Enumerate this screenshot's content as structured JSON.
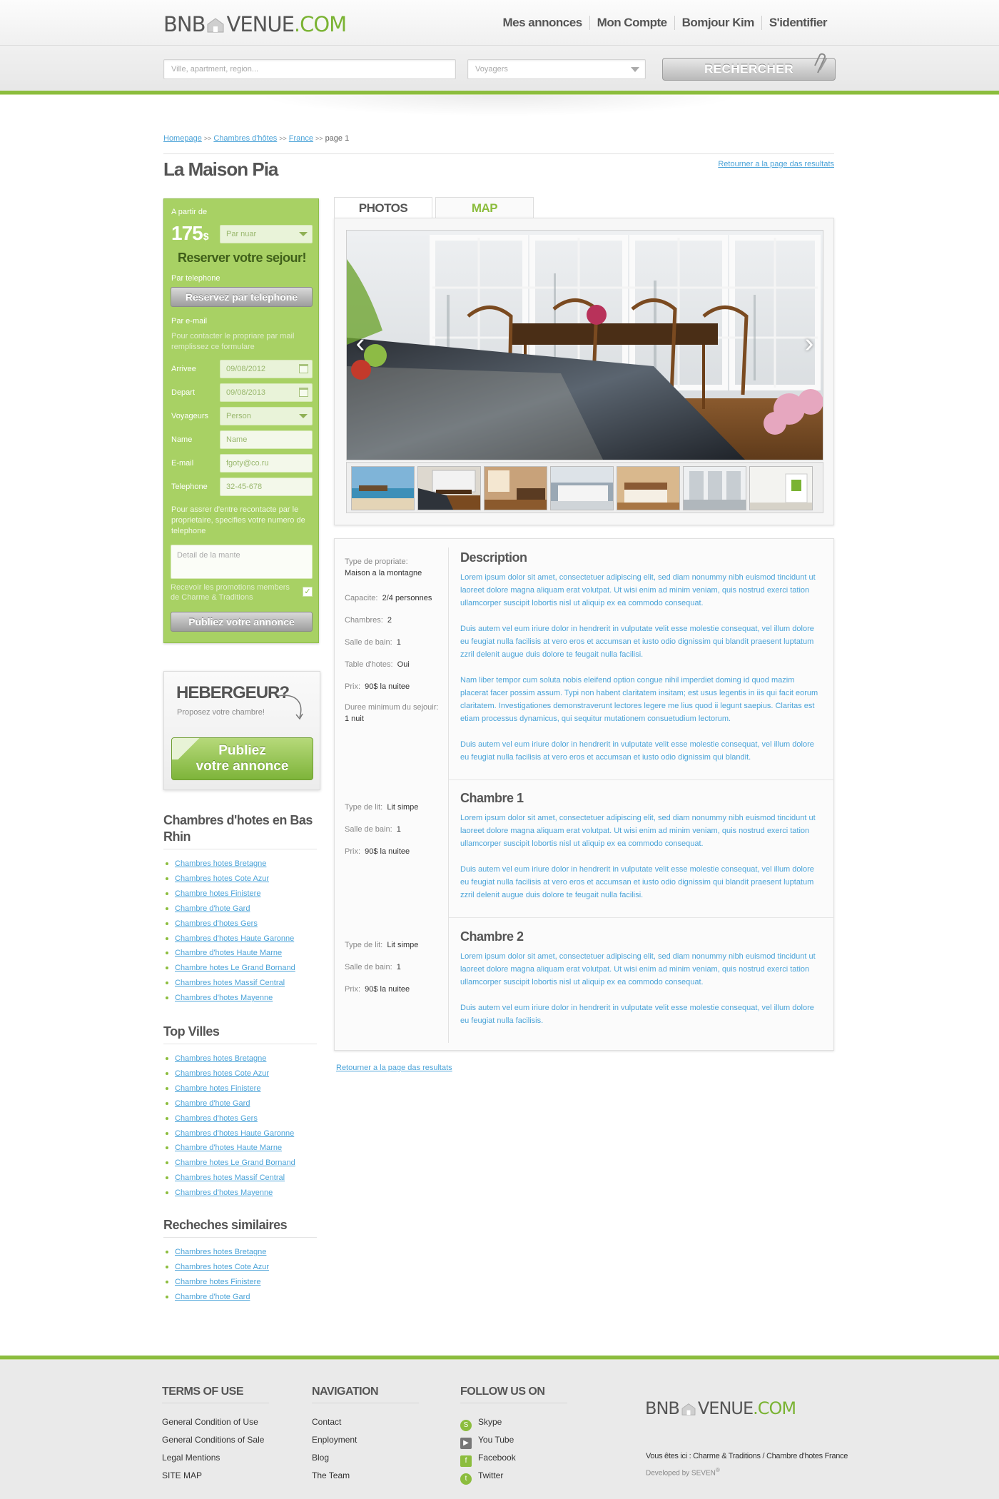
{
  "header": {
    "logo_left": "BNB",
    "logo_mid": "VENUE",
    "logo_right": ".COM",
    "nav": [
      "Mes annonces",
      "Mon Compte",
      "Bomjour Kim",
      "S'identifier"
    ],
    "search": {
      "where_placeholder": "Ville, apartment, region...",
      "guests_placeholder": "Voyagers",
      "button": "RECHERCHER"
    }
  },
  "breadcrumb": {
    "items": [
      "Homepage",
      "Chambres d'hôtes",
      "France"
    ],
    "current": "page 1",
    "sep": ">>"
  },
  "page": {
    "title": "La Maison Pia",
    "back_link": "Retourner a la page das resultats"
  },
  "booking": {
    "from_label": "A partir de",
    "price": "175",
    "currency": "$",
    "per_night": "Par nuar",
    "heading": "Reserver votre sejour!",
    "phone_label": "Par telephone",
    "phone_button": "Reservez par telephone",
    "email_label": "Par e-mail",
    "email_note": "Pour contacter le propriare par mail remplissez ce formulare",
    "fields": [
      {
        "label": "Arrivee",
        "value": "09/08/2012",
        "kind": "date"
      },
      {
        "label": "Depart",
        "value": "09/08/2013",
        "kind": "date"
      },
      {
        "label": "Voyageurs",
        "value": "Person",
        "kind": "select"
      },
      {
        "label": "Name",
        "value": "Name",
        "kind": "text"
      },
      {
        "label": "E-mail",
        "value": "fgoty@co.ru",
        "kind": "text"
      },
      {
        "label": "Telephone",
        "value": "32-45-678",
        "kind": "text"
      }
    ],
    "phone_note": "Pour assrer d'entre recontacte par le proprietaire, specifies votre numero de telephone",
    "detail_placeholder": "Detail de la mante",
    "promo": "Recevoir les promotions members de Charme & Traditions",
    "promo_checked": "✓",
    "submit": "Publiez votre annonce"
  },
  "host": {
    "title": "HEBERGEUR?",
    "subtitle": "Proposez votre chambre!",
    "button_line1": "Publiez",
    "button_line2": "votre annonce"
  },
  "sidebar": {
    "section1": {
      "title": "Chambres d'hotes en Bas Rhin",
      "items": [
        "Chambres hotes Bretagne",
        "Chambres hotes Cote Azur",
        "Chambre hotes Finistere",
        "Chambre d'hote Gard",
        "Chambres d'hotes Gers",
        "Chambres d'hotes Haute Garonne",
        "Chambre d'hotes Haute Marne",
        "Chambre hotes Le Grand Bornand",
        "Chambres hotes Massif Central",
        "Chambres d'hotes Mayenne"
      ]
    },
    "section2": {
      "title": "Top Villes",
      "items": [
        "Chambres hotes Bretagne",
        "Chambres hotes Cote Azur",
        "Chambre hotes Finistere",
        "Chambre d'hote Gard",
        "Chambres d'hotes Gers",
        "Chambres d'hotes Haute Garonne",
        "Chambre d'hotes Haute Marne",
        "Chambre hotes Le Grand Bornand",
        "Chambres hotes Massif Central",
        "Chambres d'hotes Mayenne"
      ]
    },
    "section3": {
      "title": "Recheches similaires",
      "items": [
        "Chambres hotes Bretagne",
        "Chambres hotes Cote Azur",
        "Chambre hotes Finistere",
        "Chambre d'hote Gard"
      ]
    }
  },
  "tabs": {
    "photos": "PHOTOS",
    "map": "MAP"
  },
  "gallery": {
    "prev": "‹",
    "next": "›"
  },
  "details": {
    "specs": {
      "type_label": "Type de propriate:",
      "type_value": "Maison a la montagne",
      "capacity_label": "Capacite:",
      "capacity_value": "2/4 personnes",
      "rooms_label": "Chambres:",
      "rooms_value": "2",
      "bath_label": "Salle de bain:",
      "bath_value": "1",
      "table_label": "Table d'hotes:",
      "table_value": "Oui",
      "price_label": "Prix:",
      "price_value": "90$ la nuitee",
      "min_label": "Duree minimum du sejouir:",
      "min_value": "1 nuit"
    },
    "description": {
      "title": "Description",
      "paragraphs": [
        "Lorem ipsum dolor sit amet, consectetuer adipiscing elit, sed diam nonummy nibh euismod tincidunt ut laoreet dolore magna aliquam erat volutpat. Ut wisi enim ad minim veniam, quis nostrud exerci tation ullamcorper suscipit lobortis nisl ut aliquip ex ea commodo consequat.",
        "Duis autem vel eum iriure dolor in hendrerit in vulputate velit esse molestie consequat, vel illum dolore eu feugiat nulla facilisis at vero eros et accumsan et iusto odio dignissim qui blandit praesent luptatum zzril delenit augue duis dolore te feugait nulla facilisi.",
        "Nam liber tempor cum soluta nobis eleifend option congue nihil imperdiet doming id quod mazim placerat facer possim assum. Typi non habent claritatem insitam; est usus legentis in iis qui facit eorum claritatem. Investigationes demonstraverunt lectores legere me lius quod ii legunt saepius. Claritas est etiam processus dynamicus, qui sequitur mutationem consuetudium lectorum.",
        "Duis autem vel eum iriure dolor in hendrerit in vulputate velit esse molestie consequat, vel illum dolore eu feugiat nulla facilisis at vero eros et accumsan et iusto odio dignissim qui blandit."
      ]
    },
    "room1": {
      "bed_label": "Type de lit:",
      "bed_value": "Lit simpe",
      "bath_label": "Salle de bain:",
      "bath_value": "1",
      "price_label": "Prix:",
      "price_value": "90$ la nuitee",
      "title": "Chambre 1",
      "paragraphs": [
        "Lorem ipsum dolor sit amet, consectetuer adipiscing elit, sed diam nonummy nibh euismod tincidunt ut laoreet dolore magna aliquam erat volutpat. Ut wisi enim ad minim veniam, quis nostrud exerci tation ullamcorper suscipit lobortis nisl ut aliquip ex ea commodo consequat.",
        "Duis autem vel eum iriure dolor in hendrerit in vulputate velit esse molestie consequat, vel illum dolore eu feugiat nulla facilisis at vero eros et accumsan et iusto odio dignissim qui blandit praesent luptatum zzril delenit augue duis dolore te feugait nulla facilisi."
      ]
    },
    "room2": {
      "bed_label": "Type de lit:",
      "bed_value": "Lit simpe",
      "bath_label": "Salle de bain:",
      "bath_value": "1",
      "price_label": "Prix:",
      "price_value": "90$ la nuitee",
      "title": "Chambre 2",
      "paragraphs": [
        "Lorem ipsum dolor sit amet, consectetuer adipiscing elit, sed diam nonummy nibh euismod tincidunt ut laoreet dolore magna aliquam erat volutpat. Ut wisi enim ad minim veniam, quis nostrud exerci tation ullamcorper suscipit lobortis nisl ut aliquip ex ea commodo consequat.",
        "Duis autem vel eum iriure dolor in hendrerit in vulputate velit esse molestie consequat, vel illum dolore eu feugiat nulla facilisis."
      ]
    }
  },
  "footer": {
    "terms": {
      "title": "TERMS OF USE",
      "items": [
        "General Condition of Use",
        "General Conditions of Sale",
        "Legal Mentions",
        "SITE MAP"
      ]
    },
    "navigation": {
      "title": "NAVIGATION",
      "items": [
        "Contact",
        "Enployment",
        "Blog",
        "The Team"
      ]
    },
    "follow": {
      "title": "FOLLOW US ON",
      "items": [
        "Skype",
        "You Tube",
        "Facebook",
        "Twitter"
      ],
      "icons": [
        "skype-icon",
        "youtube-icon",
        "facebook-icon",
        "twitter-icon"
      ]
    },
    "logo_left": "BNB",
    "logo_mid": "VENUE",
    "logo_right": ".COM",
    "here": "Vous êtes ici : Charme & Traditions / Chambre d'hotes France",
    "developed": "Developed by SEVEN",
    "registered": "®"
  },
  "colors": {
    "accent": "#8cbd3e",
    "link": "#4ba3d8",
    "booking_bg": "#a8d164",
    "text": "#555555"
  }
}
